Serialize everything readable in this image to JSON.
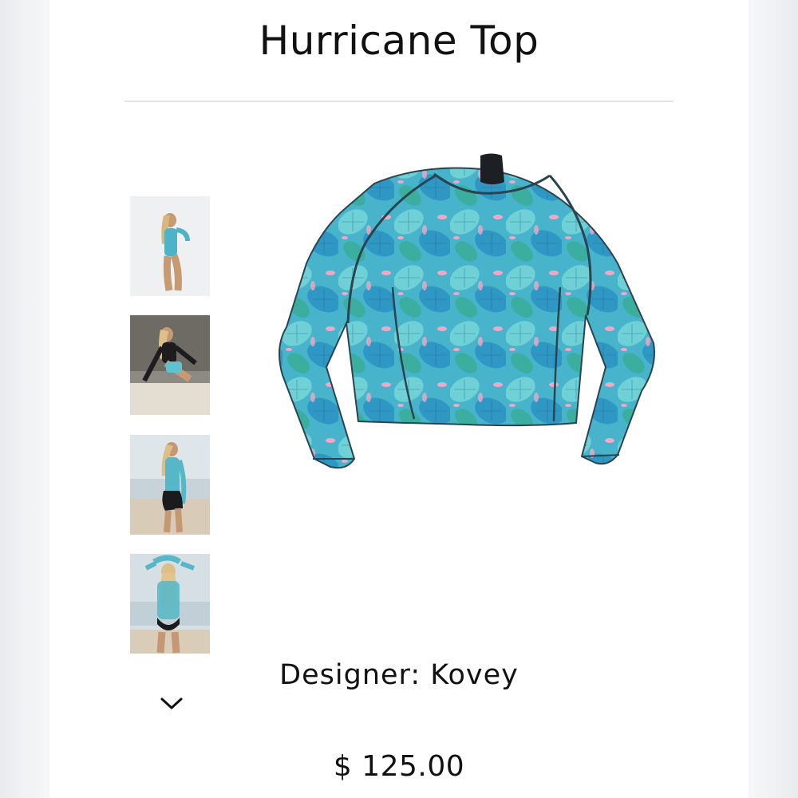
{
  "product": {
    "title": "Hurricane Top",
    "designer_label": "Designer: Kovey",
    "price": "$ 125.00"
  },
  "gallery": {
    "thumbnails": [
      {
        "name": "thumb-pose-arms-up"
      },
      {
        "name": "thumb-rocks-black-top"
      },
      {
        "name": "thumb-beach-side"
      },
      {
        "name": "thumb-back-view"
      }
    ],
    "more_icon": "chevron-down-icon"
  },
  "colors": {
    "fabric_base": "#3fb0c9",
    "fabric_light": "#6fd0d6",
    "fabric_dark": "#2b8fb2",
    "accent_pink": "#f0a8c4",
    "collar": "#1c1f24"
  }
}
